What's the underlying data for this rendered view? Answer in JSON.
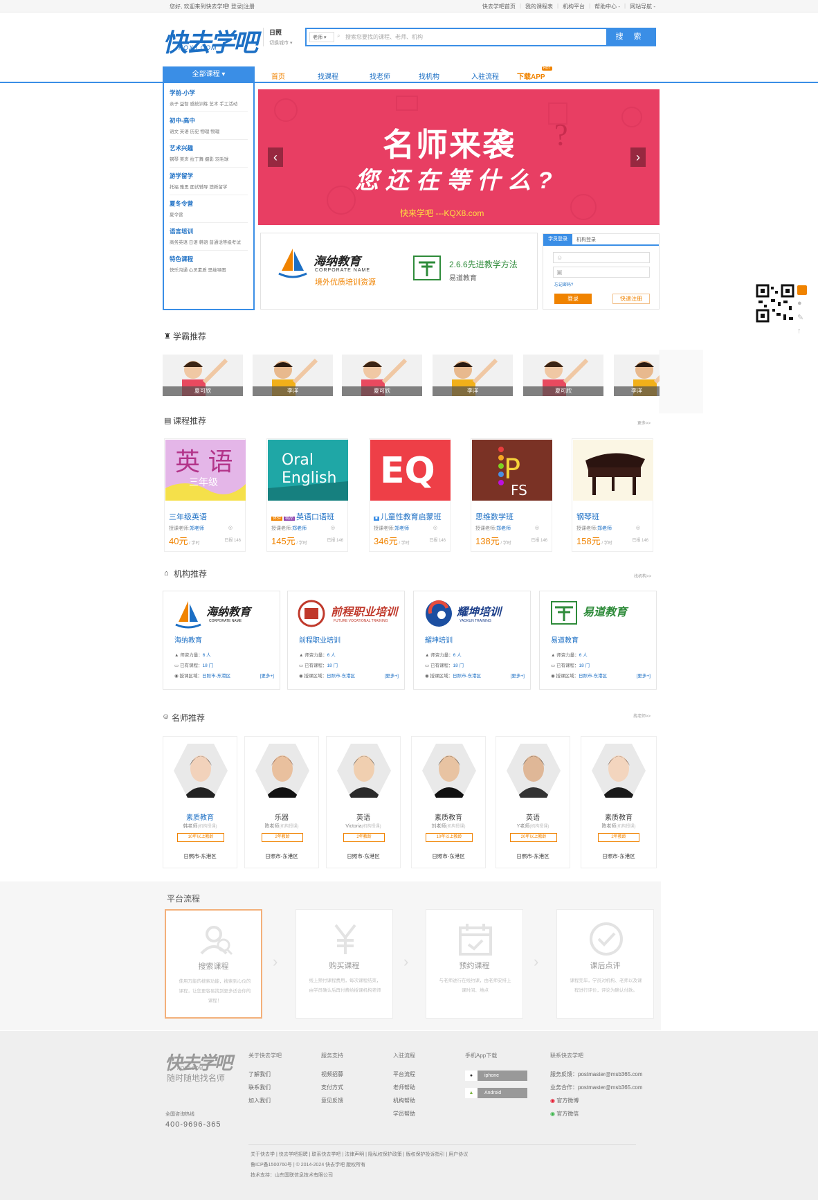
{
  "topbar": {
    "welcome": "您好, 欢迎来到快去学吧! 登录|注册",
    "links": [
      "快去学吧首页",
      "我的课程表",
      "机构平台",
      "帮助中心 -",
      "网站导航 -"
    ]
  },
  "header": {
    "logo_cn": "快去学吧",
    "logo_en": "KQX8.COM",
    "city": "日照",
    "city_switch": "切换城市 ▾",
    "search_category": "老师 ▾",
    "search_placeholder": "搜索您要找的课程、老师、机构",
    "search_button": "搜 索"
  },
  "nav": {
    "all_courses": "全部课程 ▾",
    "items": [
      "首页",
      "找课程",
      "找老师",
      "找机构",
      "入驻流程",
      "下载APP"
    ],
    "hot_badge": "HOT"
  },
  "sidemenu": [
    {
      "title": "学前-小学",
      "subs": "亲子  益智  感统训练  艺术  手工活动"
    },
    {
      "title": "初中-高中",
      "subs": "语文  英语  历史  物理  物理"
    },
    {
      "title": "艺术兴趣",
      "subs": "钢琴  美声  拉丁舞  摄影  羽毛球"
    },
    {
      "title": "游学留学",
      "subs": "托福  雅思  面试辅导  澳新留学"
    },
    {
      "title": "夏冬令营",
      "subs": "夏令营"
    },
    {
      "title": "语言培训",
      "subs": "商务英语  日语  韩语  普通话等级考试"
    },
    {
      "title": "特色课程",
      "subs": "快乐沟通  心灵素质  思维导图"
    }
  ],
  "banner": {
    "line1": "名师来袭",
    "line2": "您还在等什么?",
    "line3": "快来学吧 ---KQX8.com",
    "prev": "‹",
    "next": "›"
  },
  "promo": {
    "left_name": "海纳教育",
    "left_en": "CORPORATE NAME",
    "left_sub": "境外优质培训资源",
    "right_title": "2.6.6先进教学方法",
    "right_sub": "易道教育"
  },
  "login": {
    "tab_student": "学员登录",
    "tab_org": "机构登录",
    "forgot": "忘记密码?",
    "login_button": "登录",
    "register_button": "快速注册"
  },
  "students": {
    "title": "学霸推荐",
    "names": [
      "夏可欣",
      "李洋",
      "夏可欣",
      "李洋",
      "夏可欣",
      "李洋"
    ]
  },
  "courses": {
    "title": "课程推荐",
    "more": "更多>>",
    "items": [
      {
        "name": "三年级英语",
        "tags": [],
        "teacher_label": "授课老师:",
        "teacher": "郑老师",
        "price": "40元",
        "unit": " / 学时",
        "enrolled": "已报 146",
        "img_text1": "英 语",
        "img_text2": "三年级"
      },
      {
        "name": "英语口语班",
        "tags": [
          "体验",
          "精品"
        ],
        "teacher_label": "授课老师:",
        "teacher": "郑老师",
        "price": "145元",
        "unit": " / 学时",
        "enrolled": "已报 146",
        "img_text1": "Oral",
        "img_text2": "English"
      },
      {
        "name": "儿童性教育启蒙班",
        "tags": [
          "■"
        ],
        "teacher_label": "授课老师:",
        "teacher": "郑老师",
        "price": "346元",
        "unit": " / 学时",
        "enrolled": "已报 146",
        "img_text1": "EQ",
        "img_text2": ""
      },
      {
        "name": "思维数学班",
        "tags": [],
        "teacher_label": "授课老师:",
        "teacher": "郑老师",
        "price": "138元",
        "unit": " / 学时",
        "enrolled": "已报 146",
        "img_text1": "P",
        "img_text2": "FS"
      },
      {
        "name": "钢琴班",
        "tags": [],
        "teacher_label": "授课老师:",
        "teacher": "郑老师",
        "price": "158元",
        "unit": " / 学时",
        "enrolled": "已报 146",
        "img_text1": "",
        "img_text2": ""
      }
    ]
  },
  "orgs": {
    "title": "机构推荐",
    "more": "找机构>>",
    "row_labels": [
      "师资力量：",
      "已有课程：",
      "授课区域："
    ],
    "more_link": "[更多+]",
    "items": [
      {
        "logo": "海纳教育",
        "logo_en": "CORPORATE NAME",
        "name": "海纳教育",
        "staff": "6 人",
        "courses": "18 门",
        "area": "日照市-东港区"
      },
      {
        "logo": "前程职业培训",
        "logo_en": "FUTURE VOCATIONAL TRAINING",
        "name": "前程职业培训",
        "staff": "6 人",
        "courses": "18 门",
        "area": "日照市-东港区"
      },
      {
        "logo": "耀坤培训",
        "logo_en": "YAOKUN TRAINING",
        "name": "耀坤培训",
        "staff": "6 人",
        "courses": "18 门",
        "area": "日照市-东港区"
      },
      {
        "logo": "易道教育",
        "logo_en": "",
        "name": "易道教育",
        "staff": "6 人",
        "courses": "18 门",
        "area": "日照市-东港区"
      }
    ]
  },
  "teachers": {
    "title": "名师推荐",
    "more": "找老师>>",
    "items": [
      {
        "subject": "素质教育",
        "name": "韩老师",
        "org": "(机构授课)",
        "years": "10年以上教龄",
        "area": "日照市-东港区"
      },
      {
        "subject": "乐器",
        "name": "陈老师",
        "org": "(机构授课)",
        "years": "2年教龄",
        "area": "日照市-东港区"
      },
      {
        "subject": "英语",
        "name": "Victoria",
        "org": "(机构授课)",
        "years": "2年教龄",
        "area": "日照市-东港区"
      },
      {
        "subject": "素质教育",
        "name": "刘老师",
        "org": "(机构授课)",
        "years": "10年以上教龄",
        "area": "日照市-东港区"
      },
      {
        "subject": "英语",
        "name": "Y老师",
        "org": "(机构授课)",
        "years": "20年以上教龄",
        "area": "日照市-东港区"
      },
      {
        "subject": "素质教育",
        "name": "陈老师",
        "org": "(机构授课)",
        "years": "2年教龄",
        "area": "日照市-东港区"
      }
    ]
  },
  "flow": {
    "title": "平台流程",
    "steps": [
      {
        "title": "搜索课程",
        "desc": "使用万能的搜索功能，搜索到心仪的课程，让您更容易找到更多适合你的课程！"
      },
      {
        "title": "购买课程",
        "desc": "线上预付课程费用，每次课程结束，由学员确认后再付费给授课机构老师"
      },
      {
        "title": "预约课程",
        "desc": "与老师进行在线约课，由老师安排上课时间、地点"
      },
      {
        "title": "课后点评",
        "desc": "课程完毕，学员对机构、老师以及课程进行评价，评论为确认付款。"
      }
    ]
  },
  "footer": {
    "logo": "快去学吧",
    "logo_en": "KQX8.COM",
    "slogan": "随时随地找名师",
    "hotline_label": "全国咨询热线",
    "hotline": "400-9696-365",
    "cols": [
      {
        "title": "关于快去学吧",
        "items": [
          "了解我们",
          "联系我们",
          "加入我们"
        ]
      },
      {
        "title": "服务支持",
        "items": [
          "视频招募",
          "支付方式",
          "意见反馈"
        ]
      },
      {
        "title": "入驻流程",
        "items": [
          "平台流程",
          "老师帮助",
          "机构帮助",
          "学员帮助"
        ]
      }
    ],
    "app_title": "手机App下载",
    "apps": [
      "iphone",
      "Android"
    ],
    "contact_title": "联系快去学吧",
    "contact": [
      "服务反馈：postmaster@msb365.com",
      "业务合作：postmaster@msb365.com",
      "官方微博",
      "官方微信"
    ],
    "bottom_links": "关于快去学  |  快去学吧招聘  |  联系快去学吧  |  法律声明  |  隐私权保护政策  |  版权保护投诉指引  |  用户协议",
    "icp": "鲁ICP备1500760号 | © 2014-2024 快去学吧 版权所有",
    "support": "技术支持：山东国联信息技术有限公司"
  }
}
